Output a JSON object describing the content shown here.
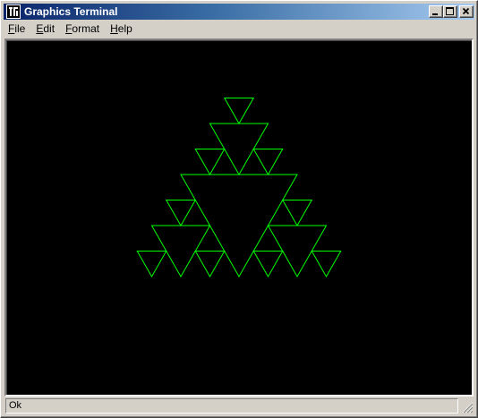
{
  "window": {
    "title": "Graphics Terminal",
    "app_icon": "tek-terminal-icon",
    "controls": [
      "minimize-icon",
      "maximize-icon",
      "close-icon"
    ]
  },
  "menu": {
    "items": [
      {
        "label": "File",
        "mnemonic": "F",
        "rest": "ile"
      },
      {
        "label": "Edit",
        "mnemonic": "E",
        "rest": "dit"
      },
      {
        "label": "Format",
        "mnemonic": "F",
        "rest": "ormat"
      },
      {
        "label": "Help",
        "mnemonic": "H",
        "rest": "elp"
      }
    ]
  },
  "canvas": {
    "background": "#000000",
    "stroke_color": "#00ff00",
    "figure": "sierpinski-inverted-triangles",
    "recursion_depth": 3
  },
  "status": {
    "text": "Ok"
  },
  "colors": {
    "title_gradient_start": "#0a246a",
    "title_gradient_end": "#a6caf0",
    "chrome": "#d4d0c8"
  }
}
